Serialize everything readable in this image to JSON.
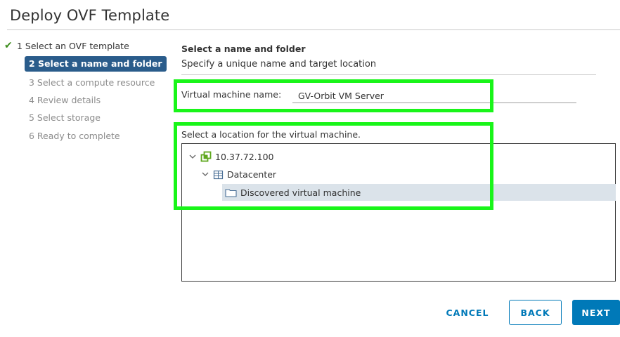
{
  "window": {
    "title": "Deploy OVF Template"
  },
  "steps": [
    {
      "label": "1 Select an OVF template",
      "state": "done"
    },
    {
      "label": "2 Select a name and folder",
      "state": "active"
    },
    {
      "label": "3 Select a compute resource",
      "state": "todo"
    },
    {
      "label": "4 Review details",
      "state": "todo"
    },
    {
      "label": "5 Select storage",
      "state": "todo"
    },
    {
      "label": "6 Ready to complete",
      "state": "todo"
    }
  ],
  "section": {
    "title": "Select a name and folder",
    "subtitle": "Specify a unique name and target location"
  },
  "vm_name": {
    "label": "Virtual machine name:",
    "value": "GV-Orbit VM Server"
  },
  "location": {
    "label": "Select a location for the virtual machine.",
    "tree": [
      {
        "label": "10.37.72.100",
        "icon": "vcenter-icon",
        "expanded": true
      },
      {
        "label": "Datacenter",
        "icon": "datacenter-icon",
        "expanded": true
      },
      {
        "label": "Discovered virtual machine",
        "icon": "folder-icon",
        "selected": true
      }
    ]
  },
  "buttons": {
    "cancel": "CANCEL",
    "back": "BACK",
    "next": "NEXT"
  },
  "colors": {
    "accent": "#0079b8",
    "active_step": "#2a5c8b",
    "check": "#3e8e1e",
    "highlight": "#19f519",
    "selected_row": "#dbe3ea"
  }
}
